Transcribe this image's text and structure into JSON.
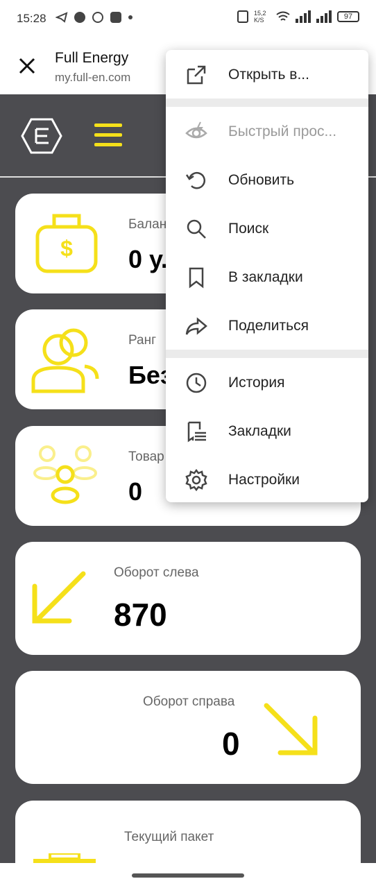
{
  "status": {
    "time": "15:28",
    "speed": "15,2 K/S",
    "battery": "97"
  },
  "tab": {
    "title": "Full Energy",
    "url": "my.full-en.com"
  },
  "cards": [
    {
      "label": "Балан",
      "value": "0 у."
    },
    {
      "label": "Ранг",
      "value": "Без"
    },
    {
      "label": "Товар",
      "value": "0"
    },
    {
      "label": "Оборот слева",
      "value": "870"
    },
    {
      "label": "Оборот справа",
      "value": "0"
    },
    {
      "label": "Текущий пакет",
      "value": ""
    }
  ],
  "menu": {
    "items": [
      {
        "label": "Открыть в...",
        "icon": "open-external-icon"
      },
      {
        "label": "Быстрый прос...",
        "icon": "quick-view-icon"
      },
      {
        "label": "Обновить",
        "icon": "refresh-icon"
      },
      {
        "label": "Поиск",
        "icon": "search-icon"
      },
      {
        "label": "В закладки",
        "icon": "bookmark-icon"
      },
      {
        "label": "Поделиться",
        "icon": "share-icon"
      },
      {
        "label": "История",
        "icon": "history-icon"
      },
      {
        "label": "Закладки",
        "icon": "bookmarks-list-icon"
      },
      {
        "label": "Настройки",
        "icon": "settings-icon"
      }
    ]
  },
  "colors": {
    "accent": "#f5e01a",
    "background": "#4c4c50"
  }
}
